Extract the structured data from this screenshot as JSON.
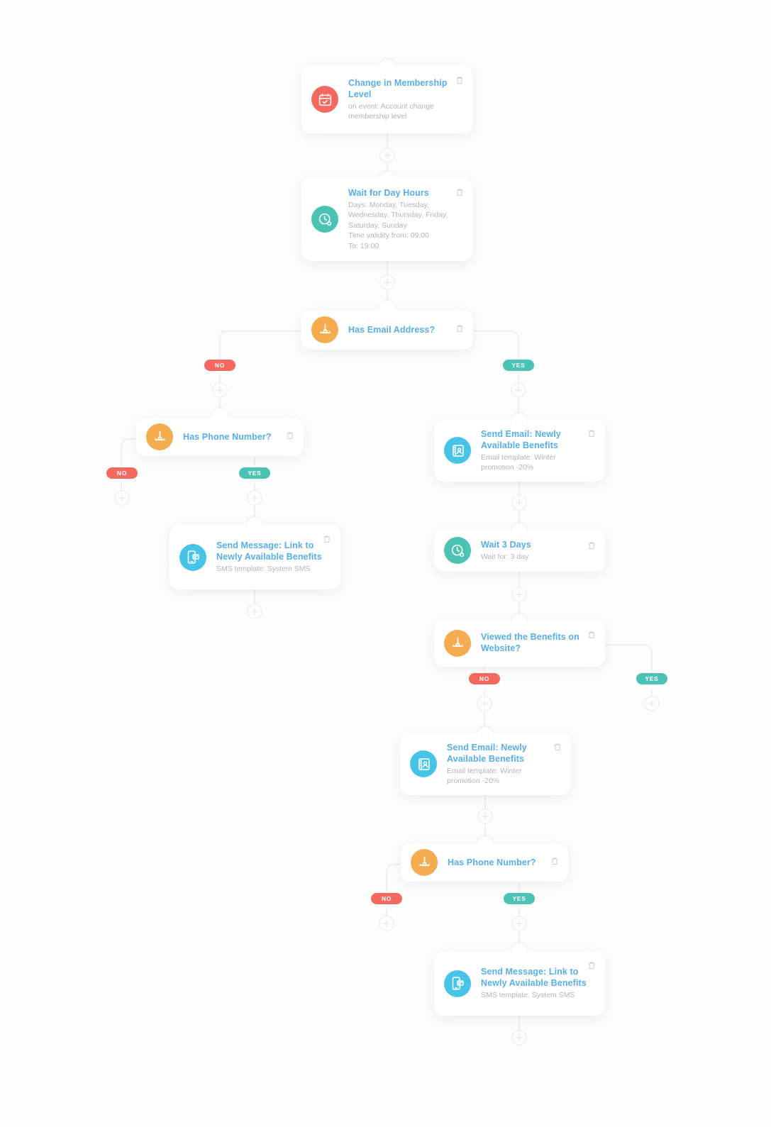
{
  "diagram": {
    "type": "workflow-automation-canvas",
    "background_color": "#fdfdfd",
    "colors": {
      "title_blue": "#56aeea",
      "desc_gray": "#b4b4b4",
      "icon_red": "#f4695f",
      "icon_teal": "#4cc2b4",
      "icon_orange": "#f5ab50",
      "icon_blue": "#48c3e8",
      "badge_no": "#f4695f",
      "badge_yes": "#4cc2b4",
      "connector": "#f0f0f0"
    },
    "branch_labels": {
      "no": "NO",
      "yes": "YES"
    },
    "nodes": [
      {
        "id": "trigger",
        "title": "Change in Membership Level",
        "desc": "on event: Account change membership level",
        "icon": "calendar-check-icon",
        "icon_color": "red"
      },
      {
        "id": "wait-day-hours",
        "title": "Wait for Day Hours",
        "desc": "Days: Monday, Tuesday, Wednesday, Thursday, Friday, Saturday, Sunday\nTime validity from: 09:00\nTo: 19:00",
        "desc_line1": "Days: Monday, Tuesday, Wednesday, Thursday, Friday, Saturday, Sunday",
        "desc_line2": "Time validity from: 09:00",
        "desc_line3": "To: 19:00",
        "icon": "clock-settings-icon",
        "icon_color": "teal"
      },
      {
        "id": "has-email",
        "title": "Has Email Address?",
        "desc": "",
        "icon": "branch-split-icon",
        "icon_color": "orange"
      },
      {
        "id": "has-phone-left",
        "title": "Has Phone Number?",
        "desc": "",
        "icon": "branch-split-icon",
        "icon_color": "orange"
      },
      {
        "id": "send-sms-left",
        "title": "Send Message: Link to Newly Available Benefits",
        "desc": "SMS template: System SMS",
        "icon": "mobile-message-icon",
        "icon_color": "blue"
      },
      {
        "id": "send-email-1",
        "title": "Send Email: Newly Available Benefits",
        "desc": "Email template: Winter promotion -20%",
        "icon": "email-contact-icon",
        "icon_color": "blue"
      },
      {
        "id": "wait-3-days",
        "title": "Wait 3 Days",
        "desc": "Wait for: 3 day",
        "icon": "clock-settings-icon",
        "icon_color": "teal"
      },
      {
        "id": "viewed-benefits",
        "title": "Viewed the Benefits on Website?",
        "desc": "",
        "icon": "branch-split-icon",
        "icon_color": "orange"
      },
      {
        "id": "send-email-2",
        "title": "Send Email: Newly Available Benefits",
        "desc": "Email template: Winter promotion -20%",
        "icon": "email-contact-icon",
        "icon_color": "blue"
      },
      {
        "id": "has-phone-right",
        "title": "Has Phone Number?",
        "desc": "",
        "icon": "branch-split-icon",
        "icon_color": "orange"
      },
      {
        "id": "send-sms-right",
        "title": "Send Message: Link to Newly Available Benefits",
        "desc": "SMS template: System SMS",
        "icon": "mobile-message-icon",
        "icon_color": "blue"
      }
    ]
  }
}
